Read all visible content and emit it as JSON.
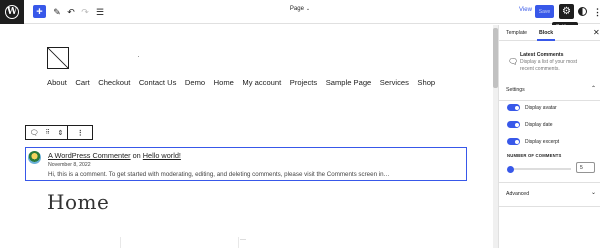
{
  "toolbar": {
    "add_label": "+",
    "doc_title": "Page",
    "view_label": "View",
    "save_label": "Save",
    "settings_tooltip": "Settings"
  },
  "site": {
    "nav": [
      "About",
      "Cart",
      "Checkout",
      "Contact Us",
      "Demo",
      "Home",
      "My account",
      "Projects",
      "Sample Page",
      "Services",
      "Shop"
    ]
  },
  "comment": {
    "author": "A WordPress Commenter",
    "on_text": "on",
    "post": "Hello world!",
    "date": "November 8, 2022",
    "excerpt": "Hi, this is a comment. To get started with moderating, editing, and deleting comments, please visit the Comments screen in…"
  },
  "page": {
    "title": "Home"
  },
  "sidebar": {
    "tabs": [
      "Template",
      "Block"
    ],
    "active_tab": "Block",
    "block_title": "Latest Comments",
    "block_desc": "Display a list of your most recent comments.",
    "settings_heading": "Settings",
    "toggles": [
      {
        "label": "Display avatar",
        "on": true
      },
      {
        "label": "Display date",
        "on": true
      },
      {
        "label": "Display excerpt",
        "on": true
      }
    ],
    "number_label": "NUMBER OF COMMENTS",
    "number_value": "5",
    "advanced_heading": "Advanced"
  },
  "colors": {
    "accent": "#3858e9",
    "dark": "#1e1e1e"
  }
}
